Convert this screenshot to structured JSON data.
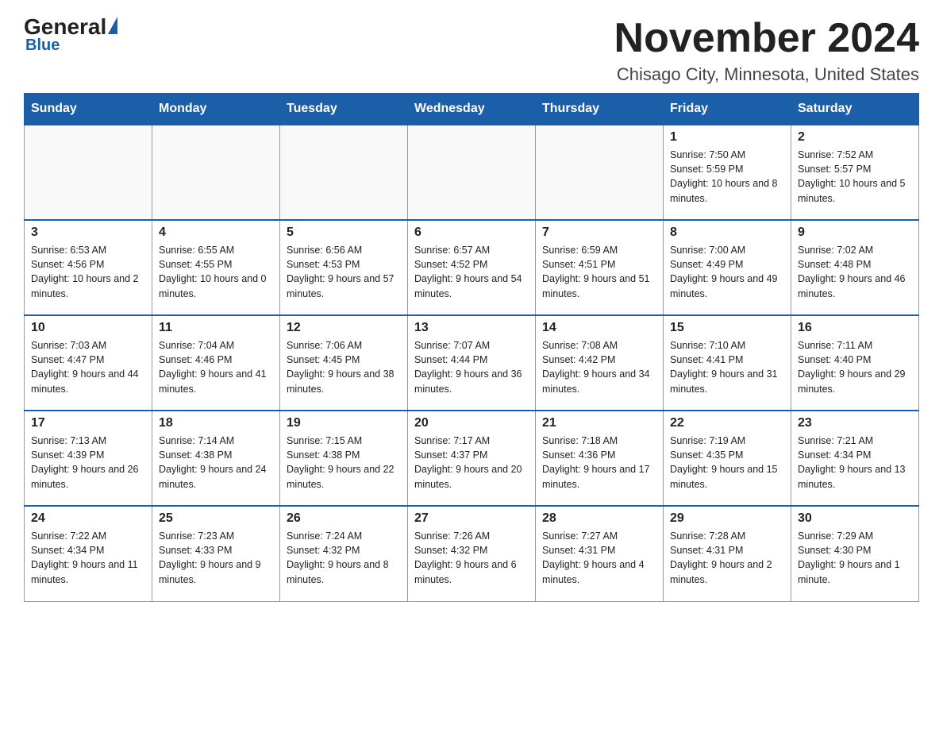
{
  "header": {
    "logo_general": "General",
    "logo_blue": "Blue",
    "month_title": "November 2024",
    "subtitle": "Chisago City, Minnesota, United States"
  },
  "days_of_week": [
    "Sunday",
    "Monday",
    "Tuesday",
    "Wednesday",
    "Thursday",
    "Friday",
    "Saturday"
  ],
  "weeks": [
    [
      {
        "day": "",
        "info": ""
      },
      {
        "day": "",
        "info": ""
      },
      {
        "day": "",
        "info": ""
      },
      {
        "day": "",
        "info": ""
      },
      {
        "day": "",
        "info": ""
      },
      {
        "day": "1",
        "info": "Sunrise: 7:50 AM\nSunset: 5:59 PM\nDaylight: 10 hours and 8 minutes."
      },
      {
        "day": "2",
        "info": "Sunrise: 7:52 AM\nSunset: 5:57 PM\nDaylight: 10 hours and 5 minutes."
      }
    ],
    [
      {
        "day": "3",
        "info": "Sunrise: 6:53 AM\nSunset: 4:56 PM\nDaylight: 10 hours and 2 minutes."
      },
      {
        "day": "4",
        "info": "Sunrise: 6:55 AM\nSunset: 4:55 PM\nDaylight: 10 hours and 0 minutes."
      },
      {
        "day": "5",
        "info": "Sunrise: 6:56 AM\nSunset: 4:53 PM\nDaylight: 9 hours and 57 minutes."
      },
      {
        "day": "6",
        "info": "Sunrise: 6:57 AM\nSunset: 4:52 PM\nDaylight: 9 hours and 54 minutes."
      },
      {
        "day": "7",
        "info": "Sunrise: 6:59 AM\nSunset: 4:51 PM\nDaylight: 9 hours and 51 minutes."
      },
      {
        "day": "8",
        "info": "Sunrise: 7:00 AM\nSunset: 4:49 PM\nDaylight: 9 hours and 49 minutes."
      },
      {
        "day": "9",
        "info": "Sunrise: 7:02 AM\nSunset: 4:48 PM\nDaylight: 9 hours and 46 minutes."
      }
    ],
    [
      {
        "day": "10",
        "info": "Sunrise: 7:03 AM\nSunset: 4:47 PM\nDaylight: 9 hours and 44 minutes."
      },
      {
        "day": "11",
        "info": "Sunrise: 7:04 AM\nSunset: 4:46 PM\nDaylight: 9 hours and 41 minutes."
      },
      {
        "day": "12",
        "info": "Sunrise: 7:06 AM\nSunset: 4:45 PM\nDaylight: 9 hours and 38 minutes."
      },
      {
        "day": "13",
        "info": "Sunrise: 7:07 AM\nSunset: 4:44 PM\nDaylight: 9 hours and 36 minutes."
      },
      {
        "day": "14",
        "info": "Sunrise: 7:08 AM\nSunset: 4:42 PM\nDaylight: 9 hours and 34 minutes."
      },
      {
        "day": "15",
        "info": "Sunrise: 7:10 AM\nSunset: 4:41 PM\nDaylight: 9 hours and 31 minutes."
      },
      {
        "day": "16",
        "info": "Sunrise: 7:11 AM\nSunset: 4:40 PM\nDaylight: 9 hours and 29 minutes."
      }
    ],
    [
      {
        "day": "17",
        "info": "Sunrise: 7:13 AM\nSunset: 4:39 PM\nDaylight: 9 hours and 26 minutes."
      },
      {
        "day": "18",
        "info": "Sunrise: 7:14 AM\nSunset: 4:38 PM\nDaylight: 9 hours and 24 minutes."
      },
      {
        "day": "19",
        "info": "Sunrise: 7:15 AM\nSunset: 4:38 PM\nDaylight: 9 hours and 22 minutes."
      },
      {
        "day": "20",
        "info": "Sunrise: 7:17 AM\nSunset: 4:37 PM\nDaylight: 9 hours and 20 minutes."
      },
      {
        "day": "21",
        "info": "Sunrise: 7:18 AM\nSunset: 4:36 PM\nDaylight: 9 hours and 17 minutes."
      },
      {
        "day": "22",
        "info": "Sunrise: 7:19 AM\nSunset: 4:35 PM\nDaylight: 9 hours and 15 minutes."
      },
      {
        "day": "23",
        "info": "Sunrise: 7:21 AM\nSunset: 4:34 PM\nDaylight: 9 hours and 13 minutes."
      }
    ],
    [
      {
        "day": "24",
        "info": "Sunrise: 7:22 AM\nSunset: 4:34 PM\nDaylight: 9 hours and 11 minutes."
      },
      {
        "day": "25",
        "info": "Sunrise: 7:23 AM\nSunset: 4:33 PM\nDaylight: 9 hours and 9 minutes."
      },
      {
        "day": "26",
        "info": "Sunrise: 7:24 AM\nSunset: 4:32 PM\nDaylight: 9 hours and 8 minutes."
      },
      {
        "day": "27",
        "info": "Sunrise: 7:26 AM\nSunset: 4:32 PM\nDaylight: 9 hours and 6 minutes."
      },
      {
        "day": "28",
        "info": "Sunrise: 7:27 AM\nSunset: 4:31 PM\nDaylight: 9 hours and 4 minutes."
      },
      {
        "day": "29",
        "info": "Sunrise: 7:28 AM\nSunset: 4:31 PM\nDaylight: 9 hours and 2 minutes."
      },
      {
        "day": "30",
        "info": "Sunrise: 7:29 AM\nSunset: 4:30 PM\nDaylight: 9 hours and 1 minute."
      }
    ]
  ]
}
